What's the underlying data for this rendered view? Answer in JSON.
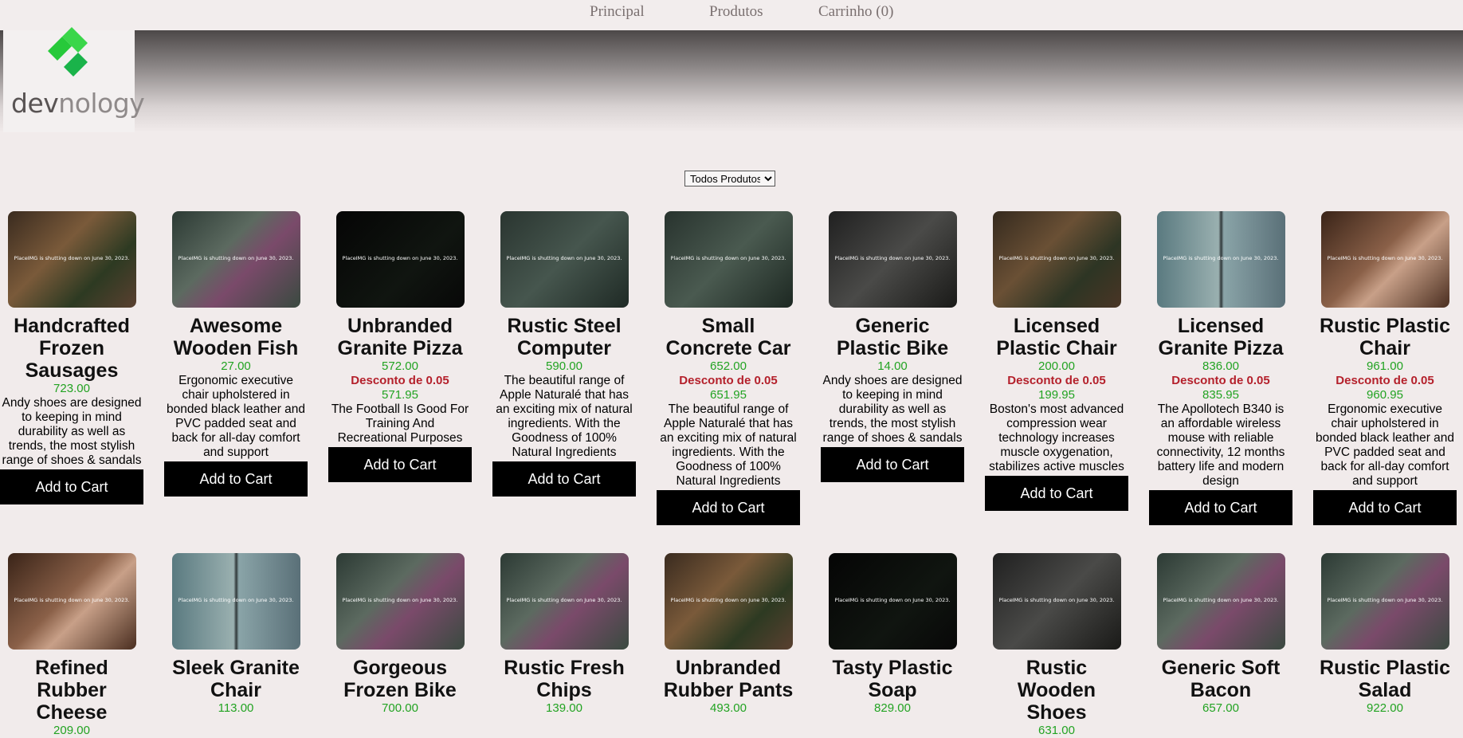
{
  "nav": {
    "items": [
      "Principal",
      "Produtos",
      "Carrinho (0)"
    ]
  },
  "logo": {
    "text_dark": "dev",
    "text_light": "nology"
  },
  "filter": {
    "selected": "Todos Produtos"
  },
  "placeholder_text": "PlaceIMG is shutting down on June 30, 2023.",
  "add_to_cart_label": "Add to Cart",
  "row1": [
    {
      "name": "Handcrafted Frozen Sausages",
      "price": "723.00",
      "discount": "",
      "final": "",
      "desc": "Andy shoes are designed to keeping in mind durability as well as trends, the most stylish range of shoes & sandals"
    },
    {
      "name": "Awesome Wooden Fish",
      "price": "27.00",
      "discount": "",
      "final": "",
      "desc": "Ergonomic executive chair upholstered in bonded black leather and PVC padded seat and back for all-day comfort and support"
    },
    {
      "name": "Unbranded Granite Pizza",
      "price": "572.00",
      "discount": "Desconto de 0.05",
      "final": "571.95",
      "desc": "The Football Is Good For Training And Recreational Purposes"
    },
    {
      "name": "Rustic Steel Computer",
      "price": "590.00",
      "discount": "",
      "final": "",
      "desc": "The beautiful range of Apple Naturalé that has an exciting mix of natural ingredients. With the Goodness of 100% Natural Ingredients"
    },
    {
      "name": "Small Concrete Car",
      "price": "652.00",
      "discount": "Desconto de 0.05",
      "final": "651.95",
      "desc": "The beautiful range of Apple Naturalé that has an exciting mix of natural ingredients. With the Goodness of 100% Natural Ingredients"
    },
    {
      "name": "Generic Plastic Bike",
      "price": "14.00",
      "discount": "",
      "final": "",
      "desc": "Andy shoes are designed to keeping in mind durability as well as trends, the most stylish range of shoes & sandals"
    },
    {
      "name": "Licensed Plastic Chair",
      "price": "200.00",
      "discount": "Desconto de 0.05",
      "final": "199.95",
      "desc": "Boston's most advanced compression wear technology increases muscle oxygenation, stabilizes active muscles"
    },
    {
      "name": "Licensed Granite Pizza",
      "price": "836.00",
      "discount": "Desconto de 0.05",
      "final": "835.95",
      "desc": "The Apollotech B340 is an affordable wireless mouse with reliable connectivity, 12 months battery life and modern design"
    },
    {
      "name": "Rustic Plastic Chair",
      "price": "961.00",
      "discount": "Desconto de 0.05",
      "final": "960.95",
      "desc": "Ergonomic executive chair upholstered in bonded black leather and PVC padded seat and back for all-day comfort and support"
    }
  ],
  "row2": [
    {
      "name": "Refined Rubber Cheese",
      "price": "209.00"
    },
    {
      "name": "Sleek Granite Chair",
      "price": "113.00"
    },
    {
      "name": "Gorgeous Frozen Bike",
      "price": "700.00"
    },
    {
      "name": "Rustic Fresh Chips",
      "price": "139.00"
    },
    {
      "name": "Unbranded Rubber Pants",
      "price": "493.00"
    },
    {
      "name": "Tasty Plastic Soap",
      "price": "829.00"
    },
    {
      "name": "Rustic Wooden Shoes",
      "price": "631.00"
    },
    {
      "name": "Generic Soft Bacon",
      "price": "657.00"
    },
    {
      "name": "Rustic Plastic Salad",
      "price": "922.00"
    }
  ],
  "colors": {
    "price": "#22a322",
    "discount": "#b4202b",
    "button": "#000000",
    "background": "#f1ebeb"
  }
}
